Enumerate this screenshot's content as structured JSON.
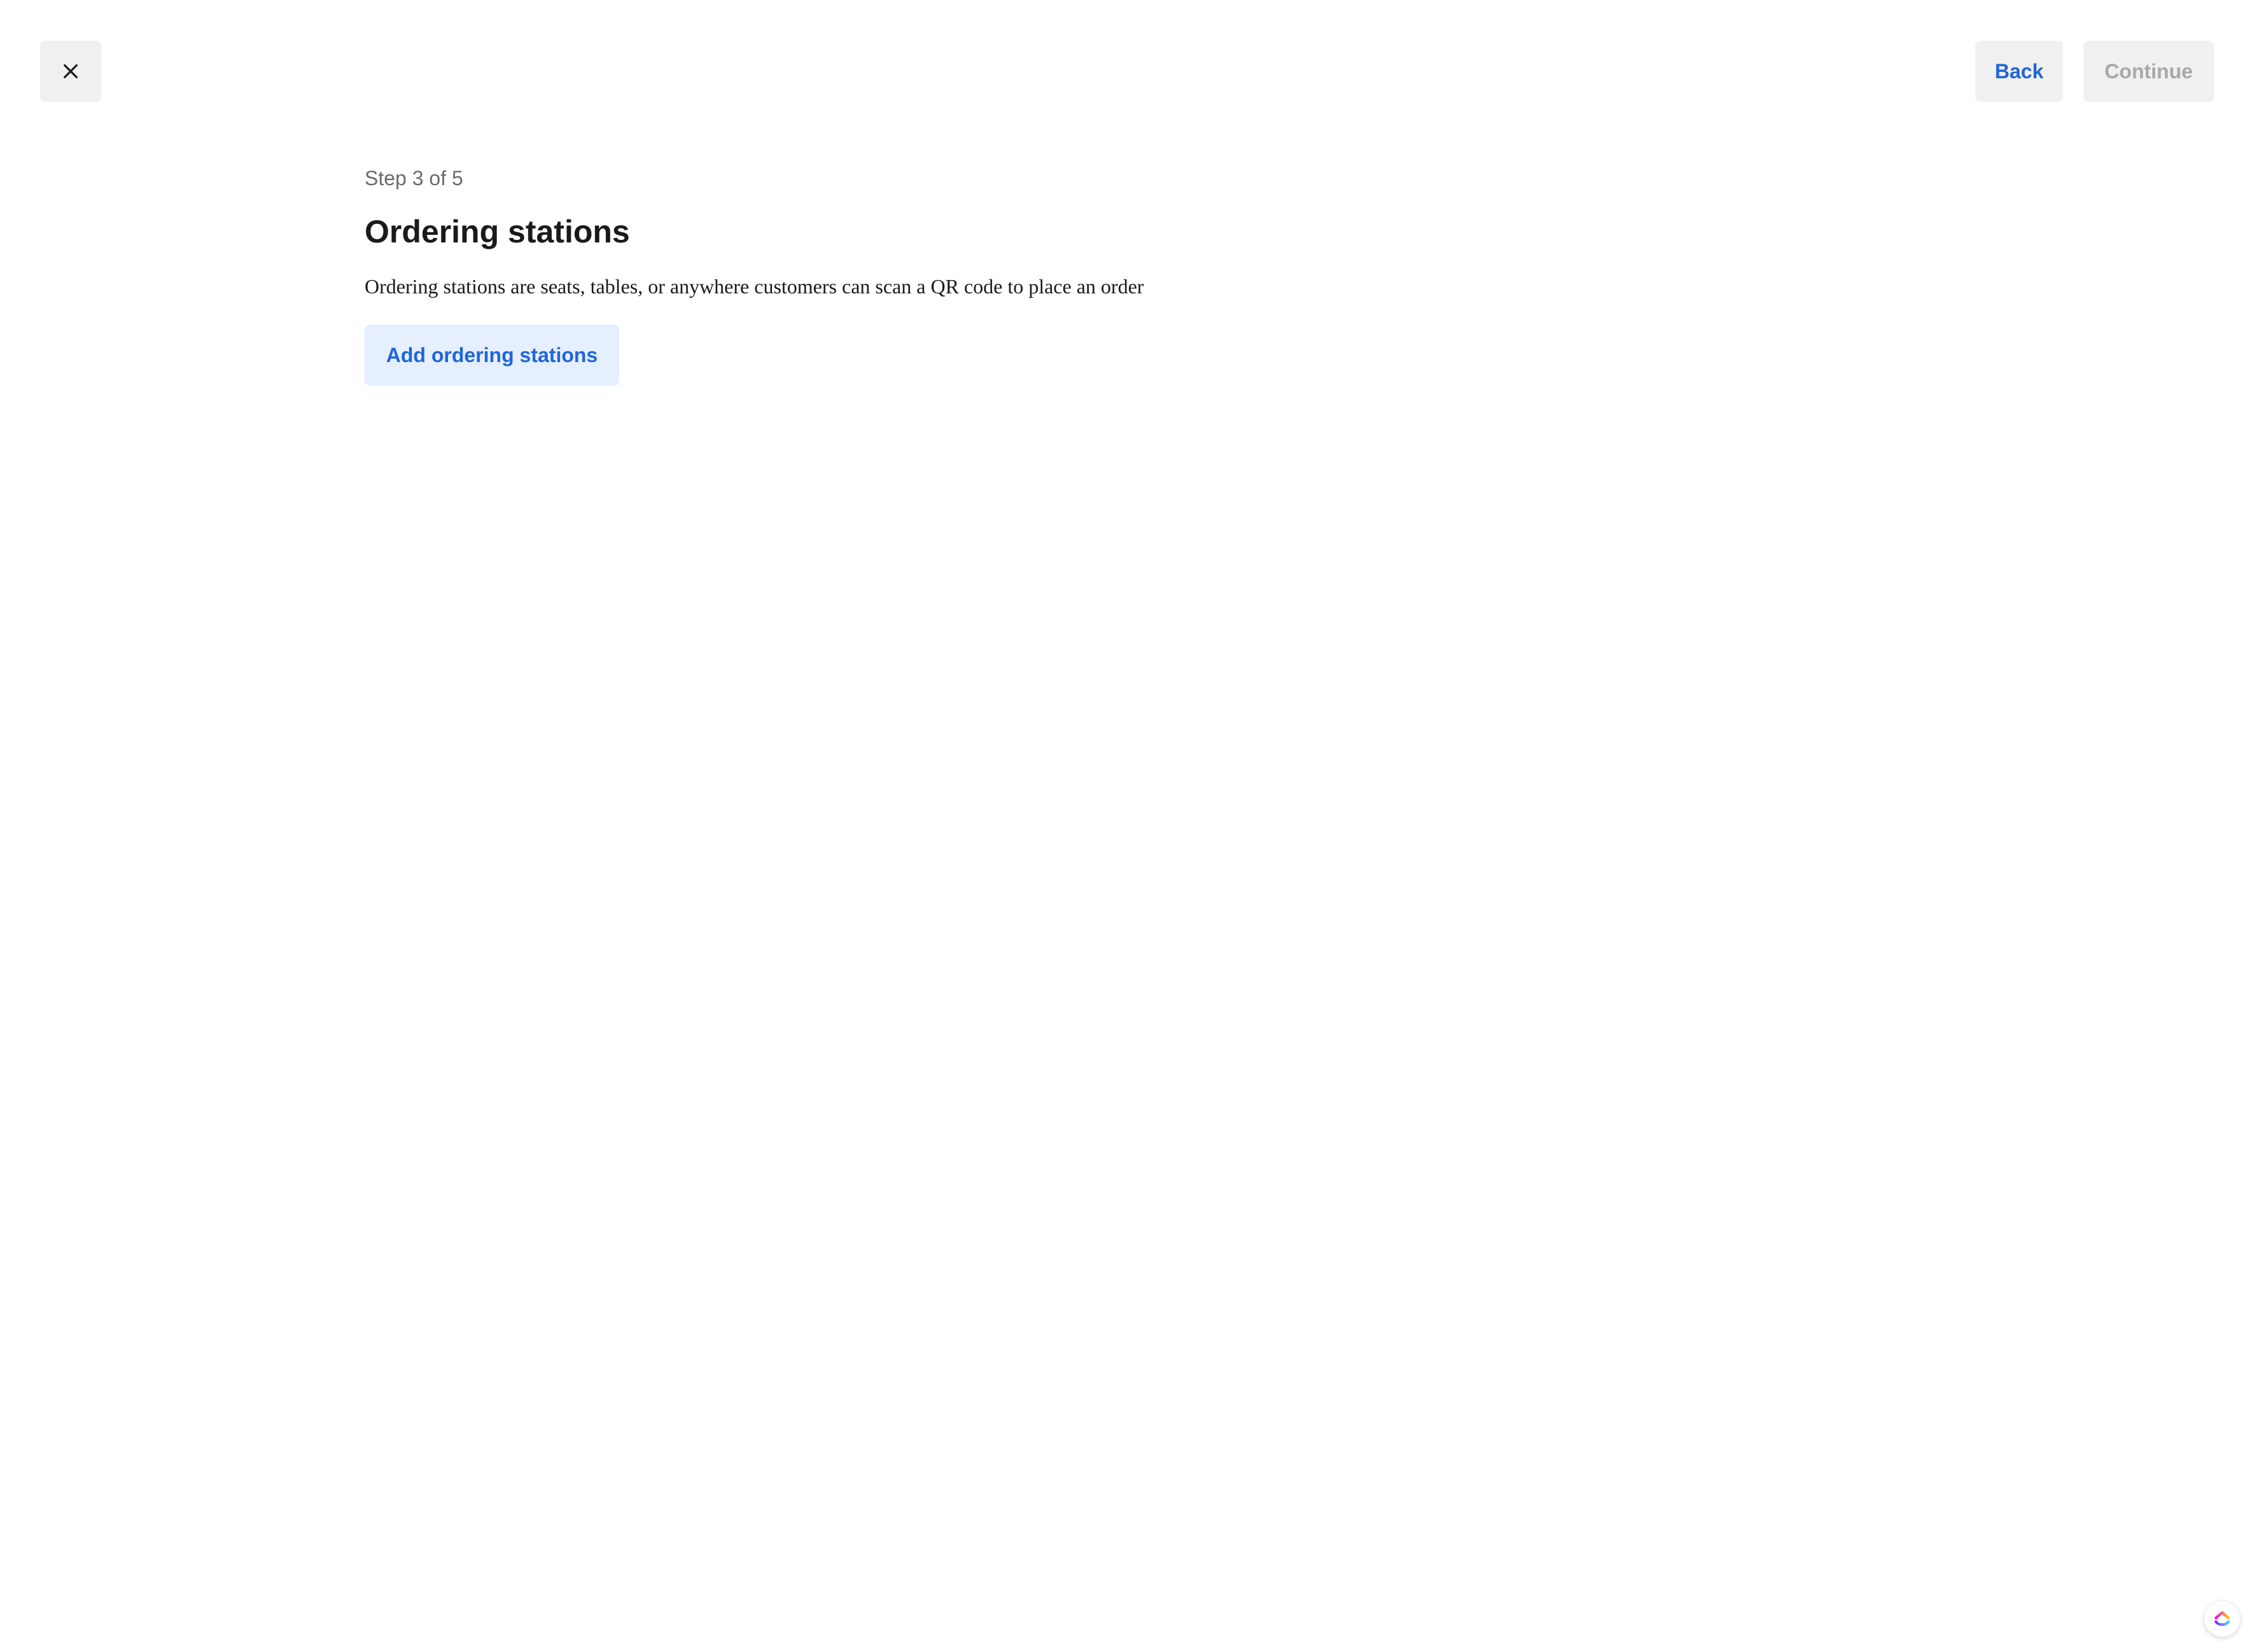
{
  "header": {
    "close_icon": "close-icon",
    "back_label": "Back",
    "continue_label": "Continue"
  },
  "main": {
    "step_text": "Step 3 of 5",
    "title": "Ordering stations",
    "description": "Ordering stations are seats, tables, or anywhere customers can scan a QR code to place an order",
    "add_button_label": "Add ordering stations"
  },
  "widget": {
    "icon": "clickup-logo-icon"
  },
  "colors": {
    "accent": "#1f66d6",
    "button_bg": "#f0f0f0",
    "add_button_bg": "#e6efff",
    "disabled_text": "#a8a8a8"
  }
}
